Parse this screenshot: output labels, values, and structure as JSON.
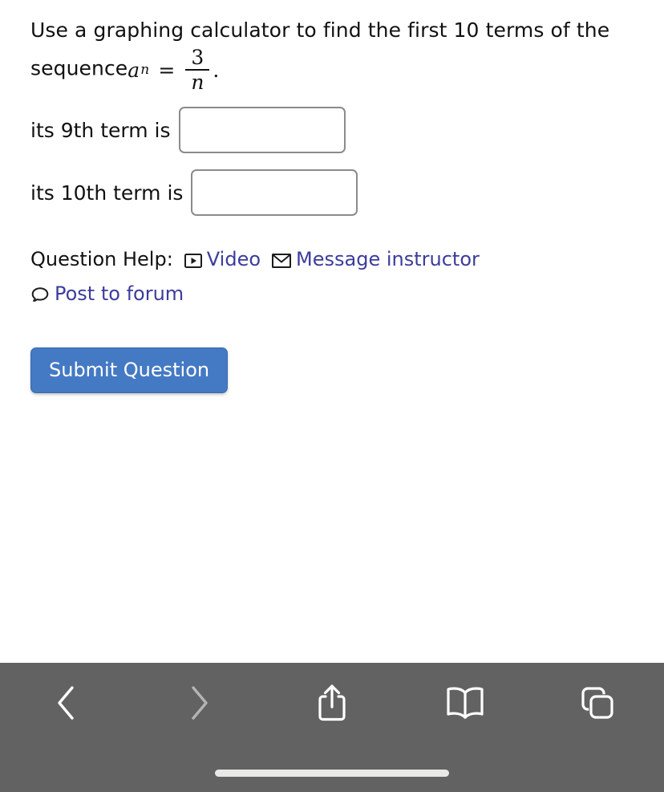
{
  "question": {
    "prompt_part1": "Use a graphing calculator to find the first 10 terms of the sequence",
    "math": {
      "variable": "a",
      "subscript": "n",
      "equals": "=",
      "numerator": "3",
      "denominator": "n",
      "period": "."
    },
    "answers": [
      {
        "label": "its 9th term is",
        "value": "",
        "placeholder": ""
      },
      {
        "label": "its 10th term is",
        "value": "",
        "placeholder": ""
      }
    ]
  },
  "question_help": {
    "label": "Question Help:",
    "links": [
      {
        "text": "Video",
        "icon": "video-play-icon"
      },
      {
        "text": "Message instructor",
        "icon": "envelope-icon"
      },
      {
        "text": "Post to forum",
        "icon": "speech-bubble-icon"
      }
    ],
    "link_color": "#3c3c9c"
  },
  "submit": {
    "label": "Submit Question",
    "background_color": "#4479c4",
    "text_color": "#ffffff"
  },
  "browser_toolbar": {
    "background_color": "#626262",
    "items": [
      {
        "name": "back",
        "icon": "chevron-left-icon",
        "enabled": true
      },
      {
        "name": "forward",
        "icon": "chevron-right-icon",
        "enabled": false
      },
      {
        "name": "share",
        "icon": "share-up-arrow-icon",
        "enabled": true
      },
      {
        "name": "bookmarks",
        "icon": "open-book-icon",
        "enabled": true
      },
      {
        "name": "tabs",
        "icon": "overlapping-squares-icon",
        "enabled": true
      }
    ],
    "home_indicator": true
  }
}
